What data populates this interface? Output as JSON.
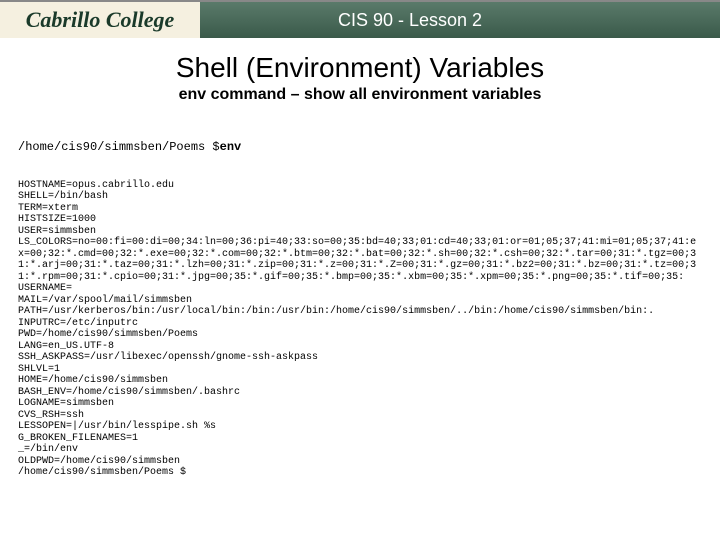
{
  "header": {
    "logo_text": "Cabrillo College",
    "course_title": "CIS 90 - Lesson 2"
  },
  "titles": {
    "main": "Shell (Environment) Variables",
    "sub": "env command – show all environment variables"
  },
  "terminal": {
    "prompt_path": "/home/cis90/simmsben/Poems $",
    "command": "env",
    "lines": [
      "HOSTNAME=opus.cabrillo.edu",
      "SHELL=/bin/bash",
      "TERM=xterm",
      "HISTSIZE=1000",
      "USER=simmsben",
      "LS_COLORS=no=00:fi=00:di=00;34:ln=00;36:pi=40;33:so=00;35:bd=40;33;01:cd=40;33;01:or=01;05;37;41:mi=01;05;37;41:ex=00;32:*.cmd=00;32:*.exe=00;32:*.com=00;32:*.btm=00;32:*.bat=00;32:*.sh=00;32:*.csh=00;32:*.tar=00;31:*.tgz=00;31:*.arj=00;31:*.taz=00;31:*.lzh=00;31:*.zip=00;31:*.z=00;31:*.Z=00;31:*.gz=00;31:*.bz2=00;31:*.bz=00;31:*.tz=00;31:*.rpm=00;31:*.cpio=00;31:*.jpg=00;35:*.gif=00;35:*.bmp=00;35:*.xbm=00;35:*.xpm=00;35:*.png=00;35:*.tif=00;35:",
      "USERNAME=",
      "MAIL=/var/spool/mail/simmsben",
      "PATH=/usr/kerberos/bin:/usr/local/bin:/bin:/usr/bin:/home/cis90/simmsben/../bin:/home/cis90/simmsben/bin:.",
      "INPUTRC=/etc/inputrc",
      "PWD=/home/cis90/simmsben/Poems",
      "LANG=en_US.UTF-8",
      "SSH_ASKPASS=/usr/libexec/openssh/gnome-ssh-askpass",
      "SHLVL=1",
      "HOME=/home/cis90/simmsben",
      "BASH_ENV=/home/cis90/simmsben/.bashrc",
      "LOGNAME=simmsben",
      "CVS_RSH=ssh",
      "LESSOPEN=|/usr/bin/lesspipe.sh %s",
      "G_BROKEN_FILENAMES=1",
      "_=/bin/env",
      "OLDPWD=/home/cis90/simmsben",
      "/home/cis90/simmsben/Poems $"
    ]
  }
}
